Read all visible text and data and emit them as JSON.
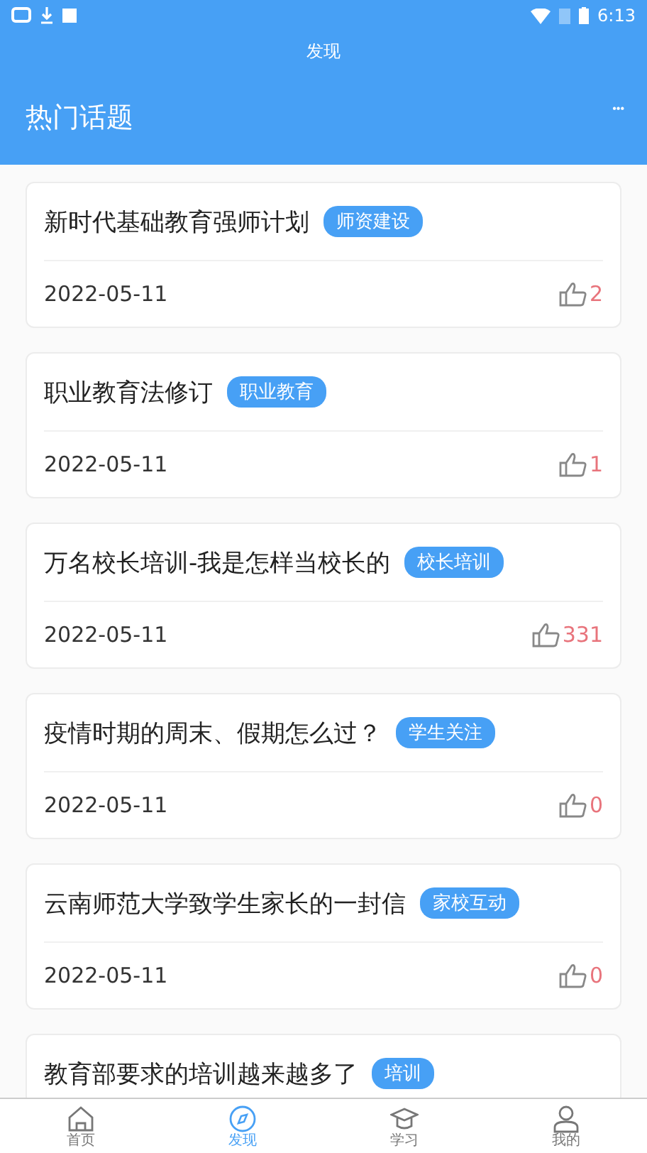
{
  "status_bar": {
    "time": "6:13"
  },
  "title": "发现",
  "header": {
    "title": "热门话题",
    "menu": "•••"
  },
  "topics": [
    {
      "title": "新时代基础教育强师计划",
      "tag": "师资建设",
      "date": "2022-05-11",
      "likes": "2"
    },
    {
      "title": "职业教育法修订",
      "tag": "职业教育",
      "date": "2022-05-11",
      "likes": "1"
    },
    {
      "title": "万名校长培训-我是怎样当校长的",
      "tag": "校长培训",
      "date": "2022-05-11",
      "likes": "331"
    },
    {
      "title": "疫情时期的周末、假期怎么过？",
      "tag": "学生关注",
      "date": "2022-05-11",
      "likes": "0"
    },
    {
      "title": "云南师范大学致学生家长的一封信",
      "tag": "家校互动",
      "date": "2022-05-11",
      "likes": "0"
    },
    {
      "title": "教育部要求的培训越来越多了",
      "tag": "培训"
    }
  ],
  "tabs": [
    {
      "label": "首页",
      "kind": "home",
      "selected": false
    },
    {
      "label": "发现",
      "kind": "discover",
      "selected": true
    },
    {
      "label": "学习",
      "kind": "study",
      "selected": false
    },
    {
      "label": "我的",
      "kind": "me",
      "selected": false
    }
  ]
}
